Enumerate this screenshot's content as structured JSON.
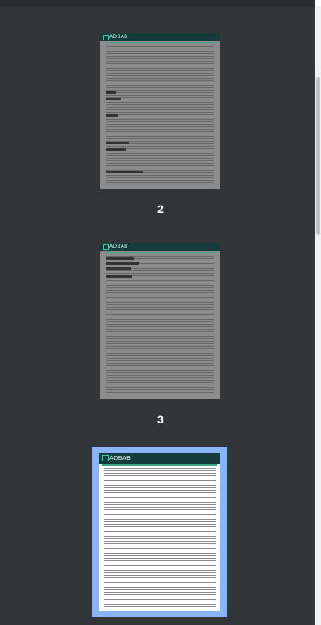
{
  "thumbnails": [
    {
      "page_number": "2",
      "brand": "ADBAB",
      "selected": false
    },
    {
      "page_number": "3",
      "brand": "ADBAB",
      "selected": false
    },
    {
      "page_number": "",
      "brand": "ADBAB",
      "selected": true
    }
  ],
  "colors": {
    "panel_background": "#323639",
    "selection_border": "#8ab4f8",
    "page_header": "#163b3d",
    "accent": "#3aa57f"
  }
}
